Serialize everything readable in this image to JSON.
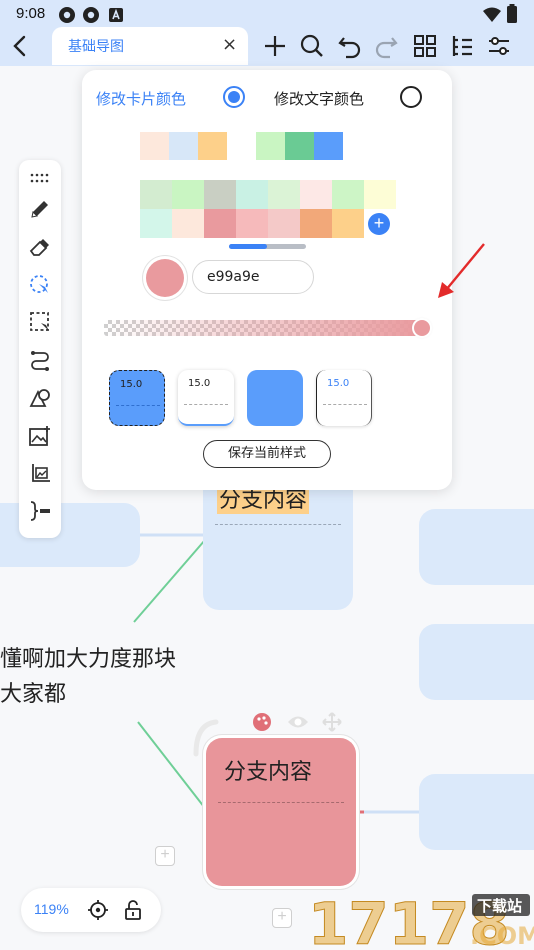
{
  "status_bar": {
    "time": "9:08"
  },
  "tab": {
    "title": "基础导图",
    "close": "×"
  },
  "color_panel": {
    "card_color_label": "修改卡片颜色",
    "text_color_label": "修改文字颜色",
    "selected_option": "card",
    "recent_colors_a": [
      "#fde8dc",
      "#d7e7f8",
      "#fdd08a"
    ],
    "recent_colors_b": [
      "#c9f5c2",
      "#6acb94",
      "#5a9dfb"
    ],
    "palette_row1": [
      "#d3ecd0",
      "#c9f5c2",
      "#c9cfc3",
      "#c9f1e4",
      "#dbf3d6",
      "#fde8e6",
      "#cdf5c6",
      "#fdfdd6"
    ],
    "palette_row2": [
      "#d3f6ea",
      "#fde8dc",
      "#e99a9e",
      "#f6babb",
      "#f4c9c8",
      "#f2a879",
      "#fdd08a"
    ],
    "hex_value": "e99a9e",
    "current_color": "#e99a9e",
    "opacity": 0.97,
    "style_presets": [
      {
        "value": "15.0"
      },
      {
        "value": "15.0"
      },
      {
        "value": ""
      },
      {
        "value": "15.0"
      }
    ],
    "save_style_label": "保存当前样式"
  },
  "canvas": {
    "branch_node_top_label": "分支内容",
    "side_text_line1": "懂啊加大力度那块",
    "side_text_line2": "大家都",
    "selected_node_label": "分支内容",
    "zoom": "119%"
  },
  "colors": {
    "accent": "#3b82f6",
    "node_fill": "#dbe9fa",
    "selected_node_fill": "#e8959a",
    "connector": "#6fcf97",
    "annotation_arrow": "#e32b2b"
  },
  "watermark": {
    "text": "17178",
    "badge": "下载站",
    "domain": ".COM"
  }
}
